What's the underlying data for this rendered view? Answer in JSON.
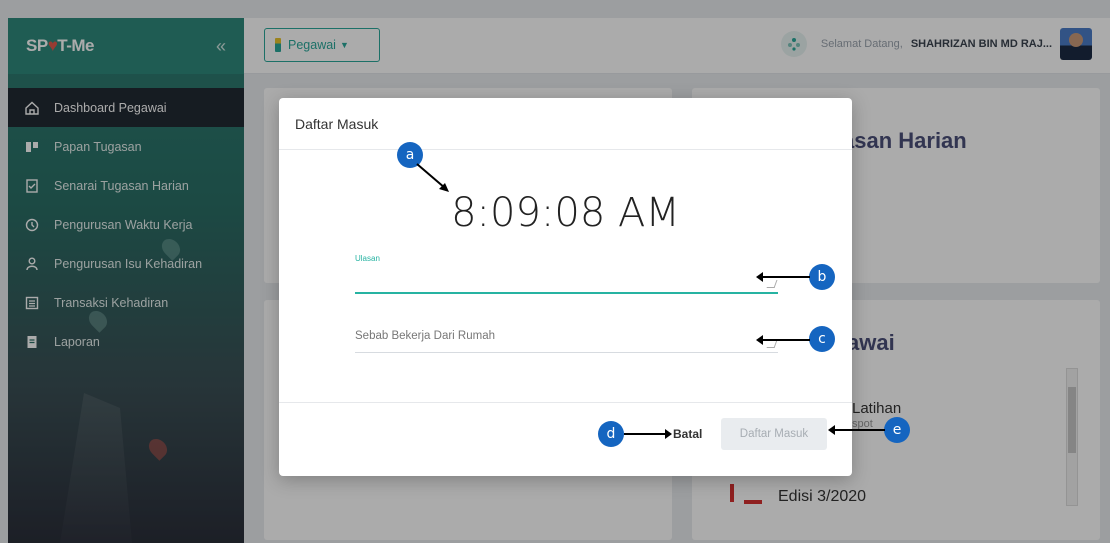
{
  "sidebar": {
    "brand": {
      "pre": "SP",
      "pin": "♥",
      "post": "T-Me"
    },
    "collapse_icon": "«",
    "items": [
      {
        "label": "Dashboard Pegawai",
        "icon": "home-icon"
      },
      {
        "label": "Papan Tugasan",
        "icon": "board-icon"
      },
      {
        "label": "Senarai Tugasan Harian",
        "icon": "checklist-icon"
      },
      {
        "label": "Pengurusan Waktu Kerja",
        "icon": "clock-icon"
      },
      {
        "label": "Pengurusan Isu Kehadiran",
        "icon": "person-icon"
      },
      {
        "label": "Transaksi Kehadiran",
        "icon": "list-icon"
      },
      {
        "label": "Laporan",
        "icon": "report-icon"
      }
    ]
  },
  "header": {
    "role_button": "Pegawai",
    "greeting": "Selamat Datang,",
    "username": "SHAHRIZAN BIN MD RAJ..."
  },
  "background": {
    "card_right_title": "asan Harian",
    "card_right2_title": "awai",
    "item_title": "Latihan",
    "item_sub": "spot",
    "item2_title": "Edisi 3/2020"
  },
  "modal": {
    "title": "Daftar Masuk",
    "time": "8:09:08 AM",
    "ulasan_label": "Ulasan",
    "wfh_placeholder": "Sebab Bekerja Dari Rumah",
    "cancel_label": "Batal",
    "submit_label": "Daftar Masuk"
  },
  "annotations": [
    "a",
    "b",
    "c",
    "d",
    "e"
  ],
  "colors": {
    "accent": "#26b3a2",
    "callout": "#1565c0",
    "sidebar_active": "#222a33"
  }
}
